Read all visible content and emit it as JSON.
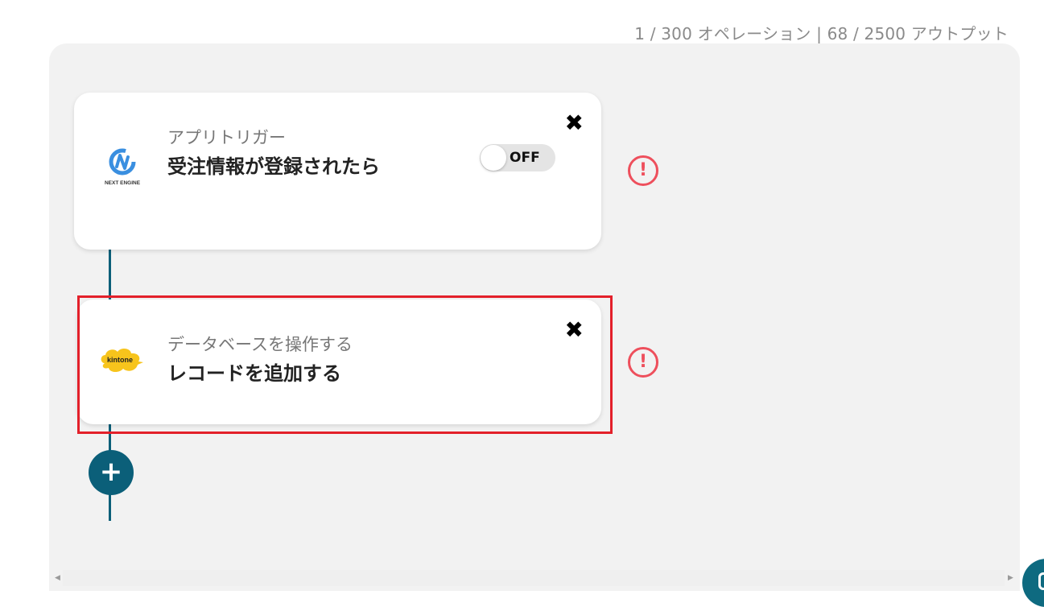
{
  "usage": {
    "text": "1 / 300 オペレーション | 68 / 2500 アウトプット"
  },
  "flow": {
    "steps": [
      {
        "app": "NEXT ENGINE",
        "subtitle": "アプリトリガー",
        "title": "受注情報が登録されたら",
        "toggle_label": "OFF",
        "toggle_on": false,
        "close_symbol": "✖",
        "warning_symbol": "!",
        "logo_icon": "next-engine-logo"
      },
      {
        "app": "kintone",
        "subtitle": "データベースを操作する",
        "title": "レコードを追加する",
        "close_symbol": "✖",
        "warning_symbol": "!",
        "logo_icon": "kintone-logo",
        "highlighted": true
      }
    ],
    "add_symbol": "+"
  },
  "colors": {
    "canvas_bg": "#f2f2f2",
    "accent": "#0b5f79",
    "warning": "#ee4f5c",
    "highlight": "#e3202a",
    "kintone_yellow": "#f7c41c",
    "next_engine_blue": "#3a8fe0"
  }
}
